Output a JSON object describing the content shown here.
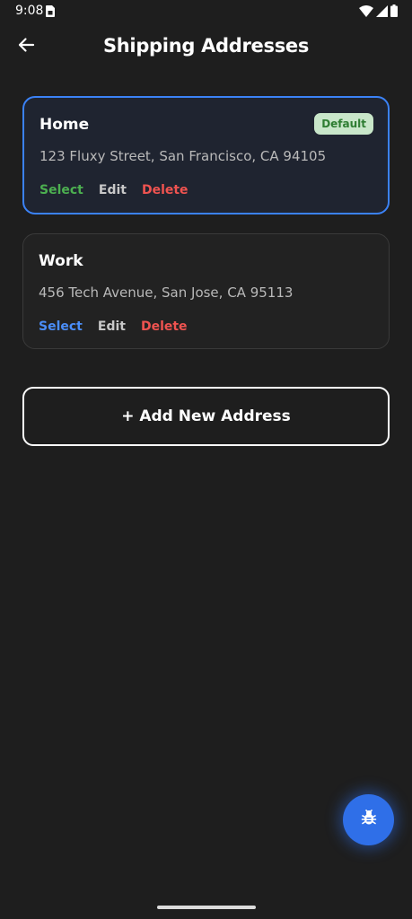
{
  "status_bar": {
    "time": "9:08",
    "icons": [
      "sim-card-icon",
      "wifi-icon",
      "cell-signal-icon",
      "battery-icon"
    ]
  },
  "header": {
    "title": "Shipping Addresses",
    "back_icon": "arrow-left-icon"
  },
  "addresses": [
    {
      "name": "Home",
      "address": "123 Fluxy Street, San Francisco, CA 94105",
      "badge": "Default",
      "selected": true,
      "actions": {
        "select": "Select",
        "edit": "Edit",
        "delete": "Delete"
      }
    },
    {
      "name": "Work",
      "address": "456 Tech Avenue, San Jose, CA 95113",
      "badge": null,
      "selected": false,
      "actions": {
        "select": "Select",
        "edit": "Edit",
        "delete": "Delete"
      }
    }
  ],
  "add_button": {
    "label": "+ Add New Address"
  },
  "fab": {
    "icon": "bug-icon"
  },
  "colors": {
    "background": "#1e1e1e",
    "selected_border": "#3b82f6",
    "select_active": "#4caf50",
    "select_inactive": "#4a8df8",
    "delete": "#ef5350",
    "badge_bg": "#c8e6c9",
    "badge_text": "#2e7d32",
    "fab": "#2f6fe8"
  }
}
